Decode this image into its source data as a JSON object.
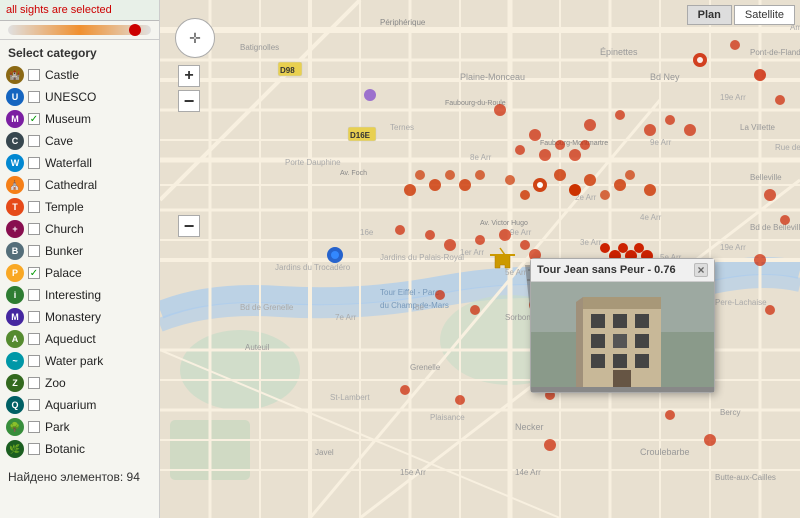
{
  "sidebar": {
    "all_selected_text": "all sights are selected",
    "select_category_label": "Select category",
    "found_text": "Найдено элементов: 94",
    "categories": [
      {
        "id": "castle",
        "label": "Castle",
        "checked": false,
        "color": "#8B6914",
        "icon": "🏰"
      },
      {
        "id": "unesco",
        "label": "UNESCO",
        "checked": false,
        "color": "#1565C0",
        "icon": "U"
      },
      {
        "id": "museum",
        "label": "Museum",
        "checked": true,
        "color": "#7B1FA2",
        "icon": "M"
      },
      {
        "id": "cave",
        "label": "Cave",
        "checked": false,
        "color": "#37474F",
        "icon": "C"
      },
      {
        "id": "waterfall",
        "label": "Waterfall",
        "checked": false,
        "color": "#0288D1",
        "icon": "W"
      },
      {
        "id": "cathedral",
        "label": "Cathedral",
        "checked": false,
        "color": "#F57F17",
        "icon": "⛪"
      },
      {
        "id": "temple",
        "label": "Temple",
        "checked": false,
        "color": "#E64A19",
        "icon": "T"
      },
      {
        "id": "church",
        "label": "Church",
        "checked": false,
        "color": "#880E4F",
        "icon": "+"
      },
      {
        "id": "bunker",
        "label": "Bunker",
        "checked": false,
        "color": "#546E7A",
        "icon": "B"
      },
      {
        "id": "palace",
        "label": "Palace",
        "checked": true,
        "color": "#F9A825",
        "icon": "P"
      },
      {
        "id": "interesting",
        "label": "Interesting",
        "checked": false,
        "color": "#2E7D32",
        "icon": "i"
      },
      {
        "id": "monastery",
        "label": "Monastery",
        "checked": false,
        "color": "#4527A0",
        "icon": "M"
      },
      {
        "id": "aqueduct",
        "label": "Aqueduct",
        "checked": false,
        "color": "#558B2F",
        "icon": "A"
      },
      {
        "id": "water_park",
        "label": "Water park",
        "checked": false,
        "color": "#0097A7",
        "icon": "~"
      },
      {
        "id": "zoo",
        "label": "Zoo",
        "checked": false,
        "color": "#33691E",
        "icon": "Z"
      },
      {
        "id": "aquarium",
        "label": "Aquarium",
        "checked": false,
        "color": "#006064",
        "icon": "Q"
      },
      {
        "id": "park",
        "label": "Park",
        "checked": false,
        "color": "#388E3C",
        "icon": "🌳"
      },
      {
        "id": "botanic",
        "label": "Botanic",
        "checked": false,
        "color": "#1B5E20",
        "icon": "🌿"
      }
    ]
  },
  "map": {
    "plan_btn": "Plan",
    "satellite_btn": "Satellite",
    "zoom_in": "+",
    "zoom_out": "−",
    "zoom_out2": "−"
  },
  "popup": {
    "title": "Tour Jean sans Peur - 0.76",
    "close": "×"
  }
}
